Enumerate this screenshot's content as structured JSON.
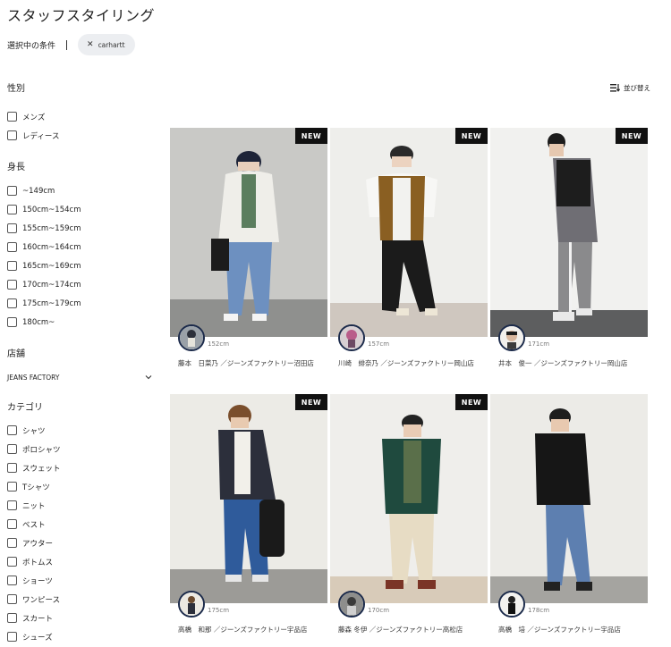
{
  "page": {
    "title": "スタッフスタイリング"
  },
  "conditions": {
    "label": "選択中の条件",
    "chips": [
      {
        "label": "carhartt"
      }
    ]
  },
  "sort": {
    "label": "並び替え"
  },
  "sidebar": {
    "gender": {
      "title": "性別",
      "items": [
        "メンズ",
        "レディース"
      ]
    },
    "height": {
      "title": "身長",
      "items": [
        "~149cm",
        "150cm~154cm",
        "155cm~159cm",
        "160cm~164cm",
        "165cm~169cm",
        "170cm~174cm",
        "175cm~179cm",
        "180cm~"
      ]
    },
    "store": {
      "title": "店舗",
      "selected": "JEANS FACTORY"
    },
    "category": {
      "title": "カテゴリ",
      "items": [
        "シャツ",
        "ポロシャツ",
        "スウェット",
        "Tシャツ",
        "ニット",
        "ベスト",
        "アウター",
        "ボトムス",
        "ショーツ",
        "ワンピース",
        "スカート",
        "シューズ"
      ]
    }
  },
  "cards": [
    {
      "badge": "NEW",
      "height": "152cm",
      "staff": "藤本　日菜乃 ／ジーンズファクトリー沼田店"
    },
    {
      "badge": "NEW",
      "height": "157cm",
      "staff": "川崎　緋奈乃 ／ジーンズファクトリー岡山店"
    },
    {
      "badge": "NEW",
      "height": "171cm",
      "staff": "井本　俊一 ／ジーンズファクトリー岡山店"
    },
    {
      "badge": "NEW",
      "height": "175cm",
      "staff": "高橋　和那 ／ジーンズファクトリー宇品店"
    },
    {
      "badge": "NEW",
      "height": "170cm",
      "staff": "藤森 冬伊 ／ジーンズファクトリー高松店"
    },
    {
      "height": "178cm",
      "staff": "高橋　培 ／ジーンズファクトリー宇品店"
    }
  ]
}
